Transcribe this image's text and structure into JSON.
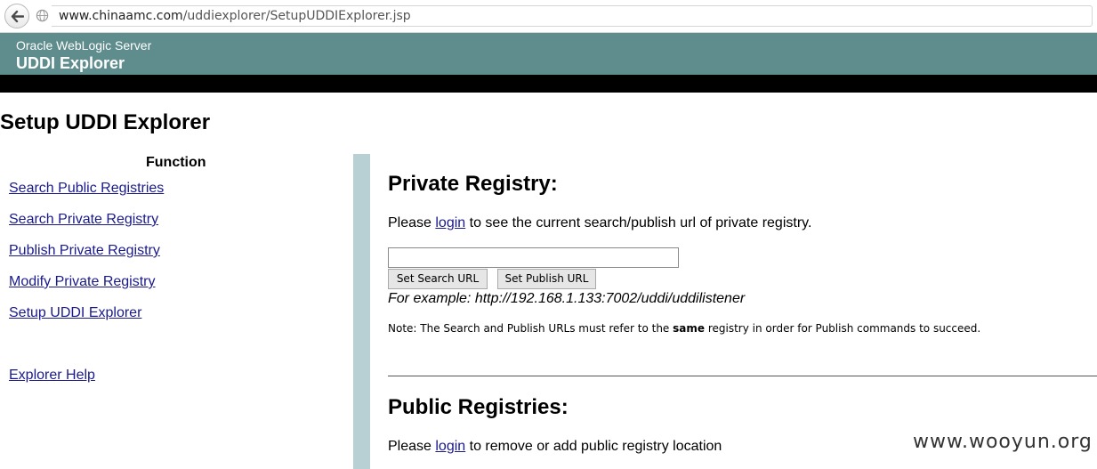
{
  "browser": {
    "url_host": "www.chinaamc.com",
    "url_path": "/uddiexplorer/SetupUDDIExplorer.jsp"
  },
  "header": {
    "product": "Oracle WebLogic Server",
    "app_title": "UDDI Explorer"
  },
  "page_title": "Setup UDDI Explorer",
  "nav": {
    "heading": "Function",
    "items": [
      {
        "label": "Search Public Registries"
      },
      {
        "label": "Search Private Registry"
      },
      {
        "label": "Publish Private Registry"
      },
      {
        "label": "Modify Private Registry"
      },
      {
        "label": "Setup UDDI Explorer"
      },
      {
        "label": "Explorer Help"
      }
    ]
  },
  "private_registry": {
    "heading": "Private Registry:",
    "text_before": "Please ",
    "login_link": "login",
    "text_after": " to see the current search/publish url of private registry.",
    "url_input_value": "",
    "set_search_button": "Set Search URL",
    "set_publish_button": "Set Publish URL",
    "example": "For example: http://192.168.1.133:7002/uddi/uddilistener",
    "note_before": "Note: The Search and Publish URLs must refer to the ",
    "note_bold": "same",
    "note_after": " registry in order for Publish commands to succeed."
  },
  "public_registries": {
    "heading": "Public Registries:",
    "text_before": "Please ",
    "login_link": "login",
    "text_after": " to remove or add public registry location"
  },
  "watermark": "www.wooyun.org",
  "colors": {
    "header_bg": "#5f8c8c",
    "divider": "#b8cfd4",
    "link": "#1a1a8c"
  }
}
